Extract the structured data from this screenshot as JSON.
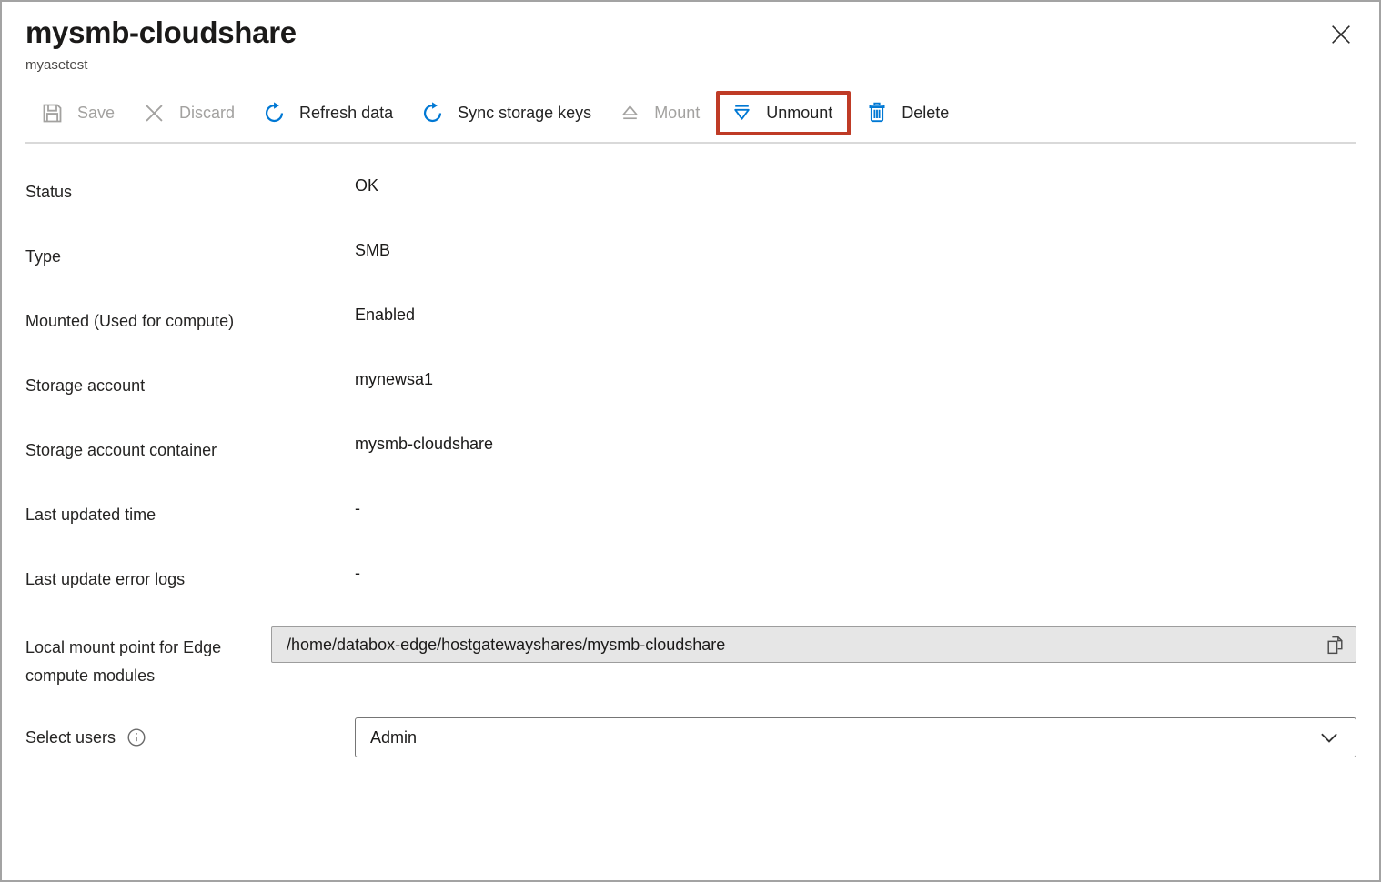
{
  "page": {
    "title": "mysmb-cloudshare",
    "subtitle": "myasetest"
  },
  "toolbar": {
    "save_label": "Save",
    "discard_label": "Discard",
    "refresh_label": "Refresh data",
    "sync_label": "Sync storage keys",
    "mount_label": "Mount",
    "unmount_label": "Unmount",
    "delete_label": "Delete"
  },
  "fields": [
    {
      "label": "Status",
      "value": "OK"
    },
    {
      "label": "Type",
      "value": "SMB"
    },
    {
      "label": "Mounted (Used for compute)",
      "value": "Enabled"
    },
    {
      "label": "Storage account",
      "value": "mynewsa1"
    },
    {
      "label": "Storage account container",
      "value": "mysmb-cloudshare"
    },
    {
      "label": "Last updated time",
      "value": "-"
    },
    {
      "label": "Last update error logs",
      "value": "-"
    }
  ],
  "mount_point": {
    "label": "Local mount point for Edge compute modules",
    "value": "/home/databox-edge/hostgatewayshares/mysmb-cloudshare"
  },
  "select_users": {
    "label": "Select users",
    "value": "Admin"
  },
  "icons": {
    "save": "floppy-disk",
    "discard": "x-mark",
    "refresh": "circular-arrow",
    "sync": "circular-arrow",
    "mount": "eject-triangle-up",
    "unmount": "triangle-down-with-bar",
    "delete": "trash-can",
    "copy": "two-pages",
    "info": "circled-i",
    "dropdown": "chevron-down",
    "close": "x-mark"
  },
  "colors": {
    "accent_blue": "#0078d4",
    "disabled_gray": "#a3a2a0",
    "annotation_red": "#bf3b26",
    "readonly_field_bg": "#e6e6e6",
    "separator": "#d9d9d9"
  }
}
